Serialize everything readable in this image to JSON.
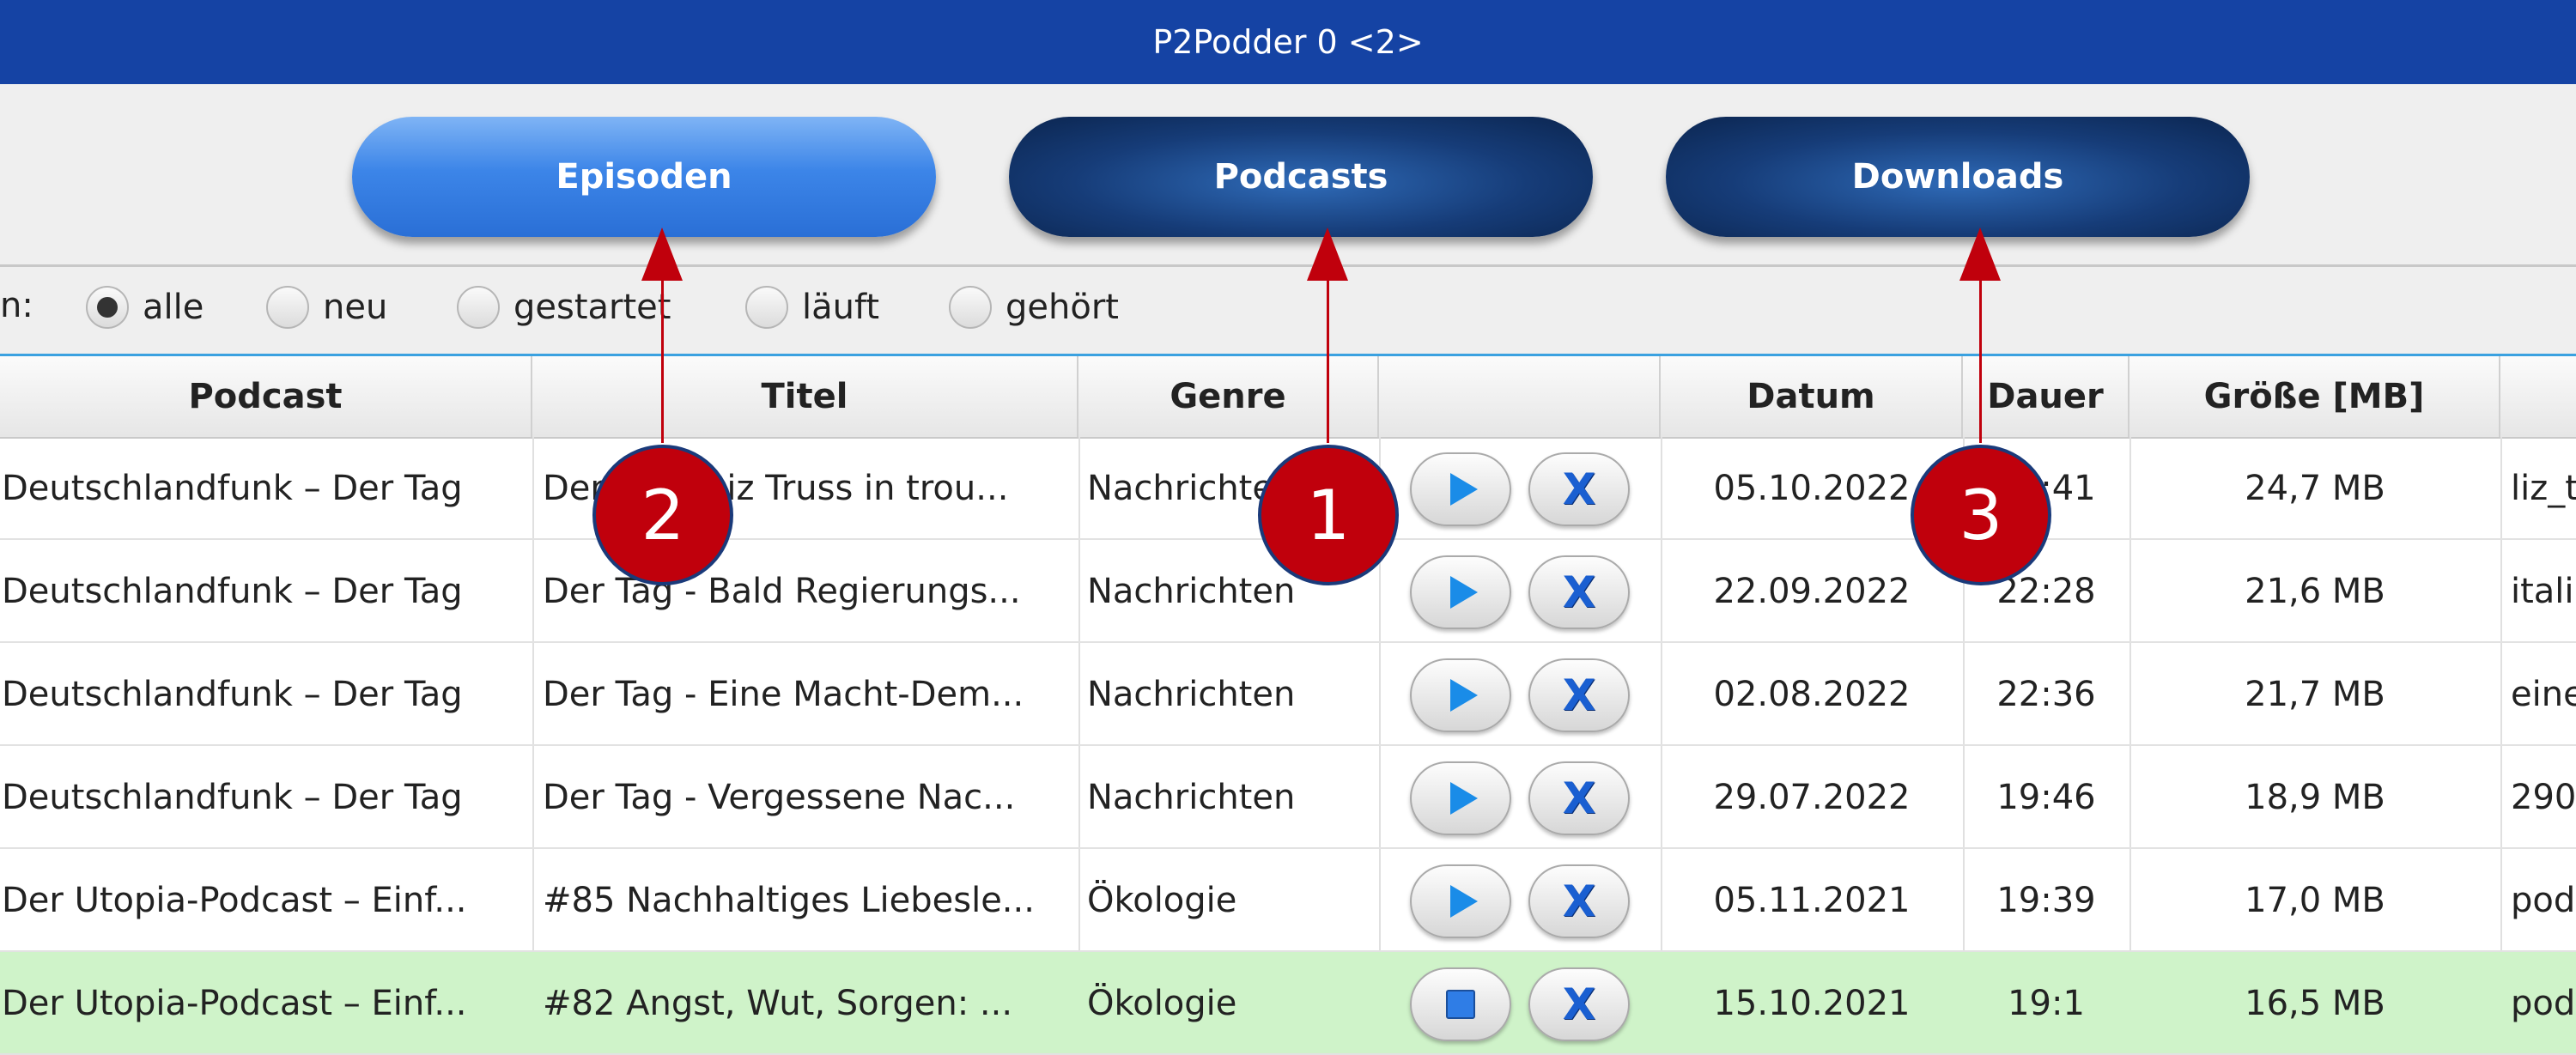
{
  "window": {
    "title": "P2Podder 0 <2>"
  },
  "tabs": [
    {
      "label": "Episoden",
      "active": true
    },
    {
      "label": "Podcasts",
      "active": false
    },
    {
      "label": "Downloads",
      "active": false
    }
  ],
  "filter": {
    "label_fragment": "n:",
    "options": [
      {
        "label": "alle",
        "selected": true
      },
      {
        "label": "neu",
        "selected": false
      },
      {
        "label": "gestartet",
        "selected": false
      },
      {
        "label": "läuft",
        "selected": false
      },
      {
        "label": "gehört",
        "selected": false
      }
    ]
  },
  "table": {
    "columns": [
      "Podcast",
      "Titel",
      "Genre",
      "",
      "Datum",
      "Dauer",
      "Größe [MB]"
    ],
    "rows": [
      {
        "podcast": "Deutschlandfunk – Der Tag",
        "title": "Der Tag - Liz Truss in trou...",
        "genre": "Nachrichten",
        "action": "play",
        "date": "05.10.2022",
        "duration": "22:41",
        "size": "24,7 MB",
        "file": "liz_t"
      },
      {
        "podcast": "Deutschlandfunk – Der Tag",
        "title": "Der Tag - Bald Regierungs...",
        "genre": "Nachrichten",
        "action": "play",
        "date": "22.09.2022",
        "duration": "22:28",
        "size": "21,6 MB",
        "file": "itali"
      },
      {
        "podcast": "Deutschlandfunk – Der Tag",
        "title": "Der Tag - Eine Macht-Dem...",
        "genre": "Nachrichten",
        "action": "play",
        "date": "02.08.2022",
        "duration": "22:36",
        "size": "21,7 MB",
        "file": "eine"
      },
      {
        "podcast": "Deutschlandfunk – Der Tag",
        "title": "Der Tag - Vergessene Nac...",
        "genre": "Nachrichten",
        "action": "play",
        "date": "29.07.2022",
        "duration": "19:46",
        "size": "18,9 MB",
        "file": "290"
      },
      {
        "podcast": "Der Utopia-Podcast – Einf...",
        "title": "#85 Nachhaltiges Liebesle...",
        "genre": "Ökologie",
        "action": "play",
        "date": "05.11.2021",
        "duration": "19:39",
        "size": "17,0 MB",
        "file": "pod"
      },
      {
        "podcast": "Der Utopia-Podcast – Einf...",
        "title": "#82 Angst, Wut, Sorgen: ...",
        "genre": "Ökologie",
        "action": "stop",
        "date": "15.10.2021",
        "duration": "19:1",
        "size": "16,5 MB",
        "file": "pod",
        "highlight": true
      }
    ]
  },
  "annotations": [
    {
      "label": "2",
      "color": "#c0000c"
    },
    {
      "label": "1",
      "color": "#c0000c"
    },
    {
      "label": "3",
      "color": "#c0000c"
    }
  ],
  "icons": {
    "play": "play-icon",
    "stop": "stop-icon",
    "delete": "x-icon"
  }
}
